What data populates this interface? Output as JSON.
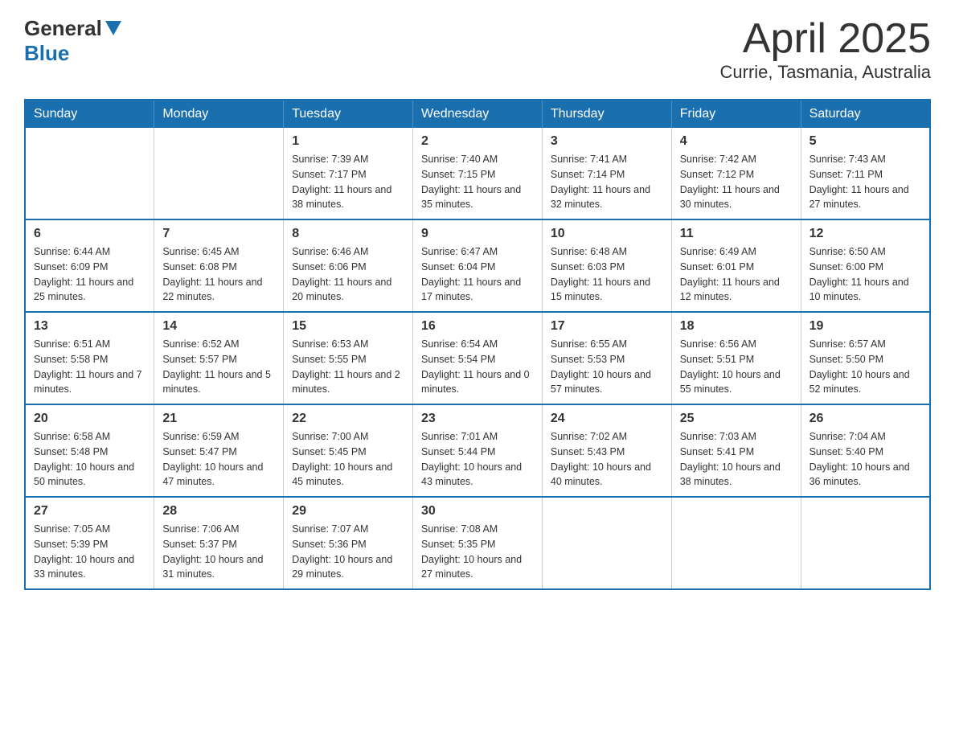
{
  "logo": {
    "general": "General",
    "blue": "Blue"
  },
  "title": "April 2025",
  "subtitle": "Currie, Tasmania, Australia",
  "weekdays": [
    "Sunday",
    "Monday",
    "Tuesday",
    "Wednesday",
    "Thursday",
    "Friday",
    "Saturday"
  ],
  "weeks": [
    [
      {
        "day": "",
        "info": ""
      },
      {
        "day": "",
        "info": ""
      },
      {
        "day": "1",
        "info": "Sunrise: 7:39 AM\nSunset: 7:17 PM\nDaylight: 11 hours\nand 38 minutes."
      },
      {
        "day": "2",
        "info": "Sunrise: 7:40 AM\nSunset: 7:15 PM\nDaylight: 11 hours\nand 35 minutes."
      },
      {
        "day": "3",
        "info": "Sunrise: 7:41 AM\nSunset: 7:14 PM\nDaylight: 11 hours\nand 32 minutes."
      },
      {
        "day": "4",
        "info": "Sunrise: 7:42 AM\nSunset: 7:12 PM\nDaylight: 11 hours\nand 30 minutes."
      },
      {
        "day": "5",
        "info": "Sunrise: 7:43 AM\nSunset: 7:11 PM\nDaylight: 11 hours\nand 27 minutes."
      }
    ],
    [
      {
        "day": "6",
        "info": "Sunrise: 6:44 AM\nSunset: 6:09 PM\nDaylight: 11 hours\nand 25 minutes."
      },
      {
        "day": "7",
        "info": "Sunrise: 6:45 AM\nSunset: 6:08 PM\nDaylight: 11 hours\nand 22 minutes."
      },
      {
        "day": "8",
        "info": "Sunrise: 6:46 AM\nSunset: 6:06 PM\nDaylight: 11 hours\nand 20 minutes."
      },
      {
        "day": "9",
        "info": "Sunrise: 6:47 AM\nSunset: 6:04 PM\nDaylight: 11 hours\nand 17 minutes."
      },
      {
        "day": "10",
        "info": "Sunrise: 6:48 AM\nSunset: 6:03 PM\nDaylight: 11 hours\nand 15 minutes."
      },
      {
        "day": "11",
        "info": "Sunrise: 6:49 AM\nSunset: 6:01 PM\nDaylight: 11 hours\nand 12 minutes."
      },
      {
        "day": "12",
        "info": "Sunrise: 6:50 AM\nSunset: 6:00 PM\nDaylight: 11 hours\nand 10 minutes."
      }
    ],
    [
      {
        "day": "13",
        "info": "Sunrise: 6:51 AM\nSunset: 5:58 PM\nDaylight: 11 hours\nand 7 minutes."
      },
      {
        "day": "14",
        "info": "Sunrise: 6:52 AM\nSunset: 5:57 PM\nDaylight: 11 hours\nand 5 minutes."
      },
      {
        "day": "15",
        "info": "Sunrise: 6:53 AM\nSunset: 5:55 PM\nDaylight: 11 hours\nand 2 minutes."
      },
      {
        "day": "16",
        "info": "Sunrise: 6:54 AM\nSunset: 5:54 PM\nDaylight: 11 hours\nand 0 minutes."
      },
      {
        "day": "17",
        "info": "Sunrise: 6:55 AM\nSunset: 5:53 PM\nDaylight: 10 hours\nand 57 minutes."
      },
      {
        "day": "18",
        "info": "Sunrise: 6:56 AM\nSunset: 5:51 PM\nDaylight: 10 hours\nand 55 minutes."
      },
      {
        "day": "19",
        "info": "Sunrise: 6:57 AM\nSunset: 5:50 PM\nDaylight: 10 hours\nand 52 minutes."
      }
    ],
    [
      {
        "day": "20",
        "info": "Sunrise: 6:58 AM\nSunset: 5:48 PM\nDaylight: 10 hours\nand 50 minutes."
      },
      {
        "day": "21",
        "info": "Sunrise: 6:59 AM\nSunset: 5:47 PM\nDaylight: 10 hours\nand 47 minutes."
      },
      {
        "day": "22",
        "info": "Sunrise: 7:00 AM\nSunset: 5:45 PM\nDaylight: 10 hours\nand 45 minutes."
      },
      {
        "day": "23",
        "info": "Sunrise: 7:01 AM\nSunset: 5:44 PM\nDaylight: 10 hours\nand 43 minutes."
      },
      {
        "day": "24",
        "info": "Sunrise: 7:02 AM\nSunset: 5:43 PM\nDaylight: 10 hours\nand 40 minutes."
      },
      {
        "day": "25",
        "info": "Sunrise: 7:03 AM\nSunset: 5:41 PM\nDaylight: 10 hours\nand 38 minutes."
      },
      {
        "day": "26",
        "info": "Sunrise: 7:04 AM\nSunset: 5:40 PM\nDaylight: 10 hours\nand 36 minutes."
      }
    ],
    [
      {
        "day": "27",
        "info": "Sunrise: 7:05 AM\nSunset: 5:39 PM\nDaylight: 10 hours\nand 33 minutes."
      },
      {
        "day": "28",
        "info": "Sunrise: 7:06 AM\nSunset: 5:37 PM\nDaylight: 10 hours\nand 31 minutes."
      },
      {
        "day": "29",
        "info": "Sunrise: 7:07 AM\nSunset: 5:36 PM\nDaylight: 10 hours\nand 29 minutes."
      },
      {
        "day": "30",
        "info": "Sunrise: 7:08 AM\nSunset: 5:35 PM\nDaylight: 10 hours\nand 27 minutes."
      },
      {
        "day": "",
        "info": ""
      },
      {
        "day": "",
        "info": ""
      },
      {
        "day": "",
        "info": ""
      }
    ]
  ]
}
